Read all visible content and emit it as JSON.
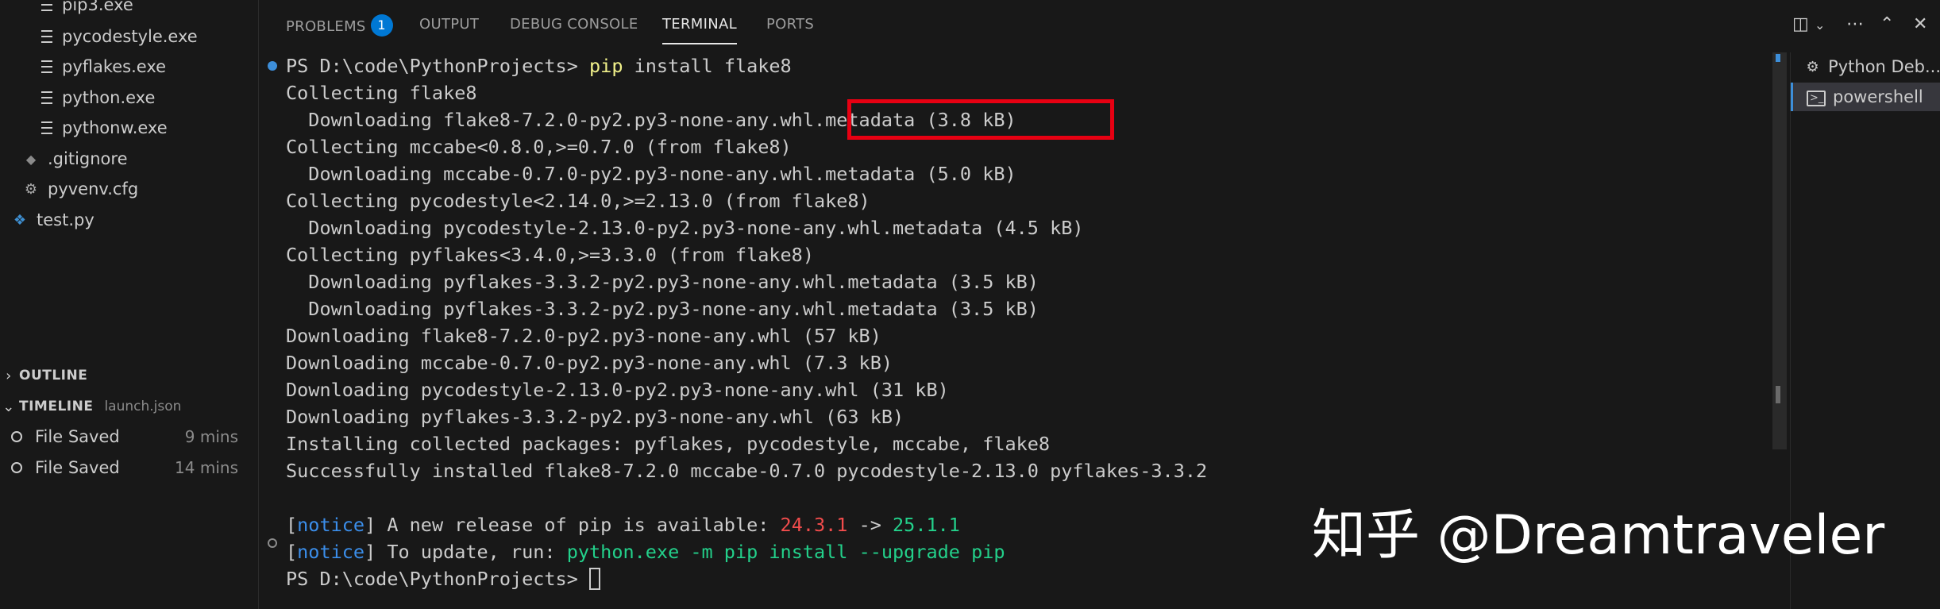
{
  "explorer": {
    "files": [
      {
        "name": "pip3.exe",
        "icon": "lines-file-icon"
      },
      {
        "name": "pycodestyle.exe",
        "icon": "lines-file-icon"
      },
      {
        "name": "pyflakes.exe",
        "icon": "lines-file-icon"
      },
      {
        "name": "python.exe",
        "icon": "lines-file-icon"
      },
      {
        "name": "pythonw.exe",
        "icon": "lines-file-icon"
      },
      {
        "name": ".gitignore",
        "icon": "git-icon"
      },
      {
        "name": "pyvenv.cfg",
        "icon": "gear-icon"
      },
      {
        "name": "test.py",
        "icon": "python-icon"
      }
    ]
  },
  "outline": {
    "title": "OUTLINE"
  },
  "timeline": {
    "title": "TIMELINE",
    "file": "launch.json",
    "items": [
      {
        "label": "File Saved",
        "when": "9 mins"
      },
      {
        "label": "File Saved",
        "when": "14 mins"
      }
    ]
  },
  "panel": {
    "tabs": [
      {
        "label": "PROBLEMS",
        "badge": "1"
      },
      {
        "label": "OUTPUT"
      },
      {
        "label": "DEBUG CONSOLE"
      },
      {
        "label": "TERMINAL",
        "active": true
      },
      {
        "label": "PORTS"
      }
    ]
  },
  "terminal": {
    "prompt": "PS D:\\code\\PythonProjects",
    "prompt_symbol": ">",
    "command": {
      "program": "pip",
      "args": " install flake8"
    },
    "output": [
      "Collecting flake8",
      "  Downloading flake8-7.2.0-py2.py3-none-any.whl.metadata (3.8 kB)",
      "Collecting mccabe<0.8.0,>=0.7.0 (from flake8)",
      "  Downloading mccabe-0.7.0-py2.py3-none-any.whl.metadata (5.0 kB)",
      "Collecting pycodestyle<2.14.0,>=2.13.0 (from flake8)",
      "  Downloading pycodestyle-2.13.0-py2.py3-none-any.whl.metadata (4.5 kB)",
      "Collecting pyflakes<3.4.0,>=3.3.0 (from flake8)",
      "  Downloading pyflakes-3.3.2-py2.py3-none-any.whl.metadata (3.5 kB)",
      "  Downloading pyflakes-3.3.2-py2.py3-none-any.whl.metadata (3.5 kB)",
      "Downloading flake8-7.2.0-py2.py3-none-any.whl (57 kB)",
      "Downloading mccabe-0.7.0-py2.py3-none-any.whl (7.3 kB)",
      "Downloading pycodestyle-2.13.0-py2.py3-none-any.whl (31 kB)",
      "Downloading pyflakes-3.3.2-py2.py3-none-any.whl (63 kB)",
      "Installing collected packages: pyflakes, pycodestyle, mccabe, flake8",
      "Successfully installed flake8-7.2.0 mccabe-0.7.0 pycodestyle-2.13.0 pyflakes-3.3.2"
    ],
    "notice1": {
      "open": "[",
      "tag": "notice",
      "close": "]",
      "text": " A new release of pip is available: ",
      "old_version": "24.3.1",
      "arrow": " -> ",
      "new_version": "25.1.1"
    },
    "notice2": {
      "open": "[",
      "tag": "notice",
      "close": "]",
      "text": " To update, run: ",
      "cmd": "python.exe -m pip install --upgrade pip"
    }
  },
  "terminal_list": [
    {
      "label": "Python Deb...",
      "icon": "bug-icon"
    },
    {
      "label": "powershell",
      "icon": "terminal-icon",
      "selected": true
    }
  ],
  "watermark": "知乎 @Dreamtraveler",
  "colors": {
    "background": "#181818",
    "highlight_box": "#e60012",
    "notice_tag": "#3b8eea",
    "old_version": "#f14c4c",
    "new_version": "#23d18b",
    "command": "#f1f18a",
    "badge": "#0078d4"
  }
}
